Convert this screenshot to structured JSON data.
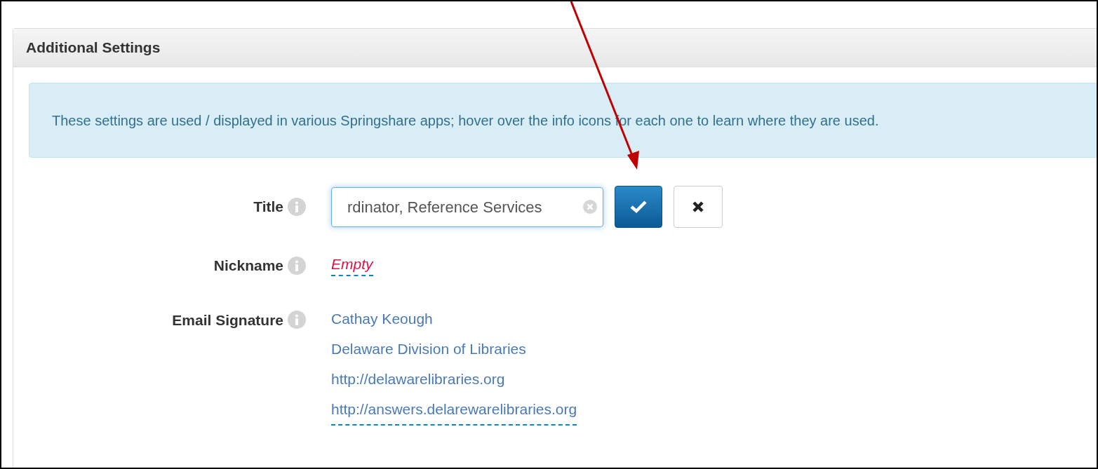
{
  "panel": {
    "title": "Additional Settings"
  },
  "notice": "These settings are used / displayed in various Springshare apps; hover over the info icons for each one to learn where they are used.",
  "fields": [
    {
      "label": "Title",
      "kind": "input",
      "value": "rdinator, Reference Services"
    },
    {
      "label": "Nickname",
      "kind": "empty",
      "text": "Empty"
    },
    {
      "label": "Email Signature",
      "kind": "lines",
      "lines": [
        "Cathay Keough",
        "Delaware Division of Libraries",
        "http://delawarelibraries.org",
        "http://answers.delarewarelibraries.org"
      ]
    }
  ]
}
